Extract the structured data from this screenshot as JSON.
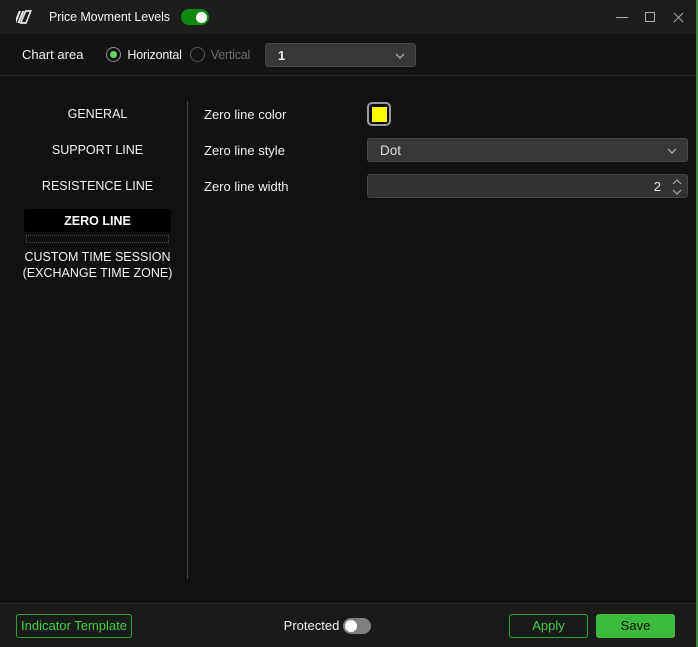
{
  "titlebar": {
    "title": "Price Movment Levels",
    "logo_icon": "app-logo-slashes",
    "indicator_enabled_toggle": {
      "state": "on",
      "color": "#0f880f"
    },
    "window_buttons": [
      "minimize",
      "maximize",
      "close"
    ]
  },
  "chart_area": {
    "label": "Chart area",
    "radio_options": [
      {
        "label": "Horizontal",
        "selected": true,
        "enabled": true
      },
      {
        "label": "Vertical",
        "selected": false,
        "enabled": false
      }
    ],
    "area_select": {
      "value": "1"
    }
  },
  "sidebar": {
    "items": [
      {
        "lines": [
          "GENERAL"
        ],
        "selected": false
      },
      {
        "lines": [
          "SUPPORT LINE"
        ],
        "selected": false
      },
      {
        "lines": [
          "RESISTENCE LINE"
        ],
        "selected": false
      },
      {
        "lines": [
          "ZERO LINE"
        ],
        "selected": true
      },
      {
        "lines": [
          "CUSTOM TIME SESSION",
          "(EXCHANGE TIME ZONE)"
        ],
        "selected": false
      }
    ]
  },
  "settings": {
    "rows": [
      {
        "label": "Zero line color",
        "control": "color-swatch",
        "value": "#f9f900"
      },
      {
        "label": "Zero line style",
        "control": "dropdown",
        "value": "Dot"
      },
      {
        "label": "Zero line width",
        "control": "number-stepper",
        "value": "2"
      }
    ]
  },
  "footer": {
    "indicator_template_label": "Indicator Template",
    "protected_label": "Protected",
    "protected_toggle": {
      "state": "off"
    },
    "apply_label": "Apply",
    "save_label": "Save"
  },
  "colors": {
    "accent_green": "#3dbb3d",
    "outline_green": "#2da02d",
    "toggle_green": "#0f880f",
    "swatch_yellow": "#f9f900",
    "window_border_green": "#3f8a3f"
  }
}
